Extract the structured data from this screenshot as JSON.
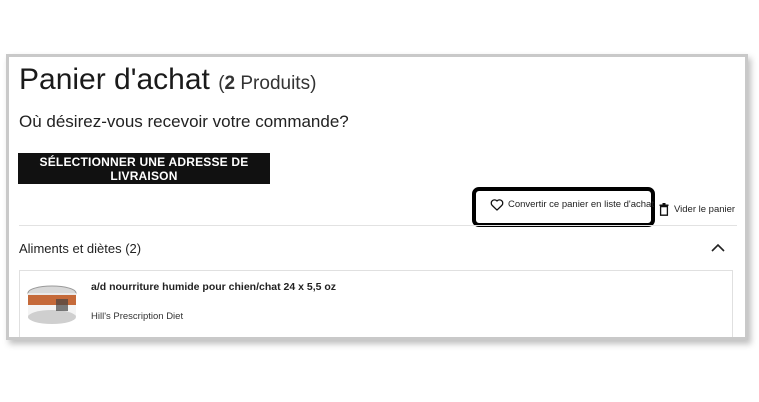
{
  "cart": {
    "title": "Panier d'achat",
    "count_open": "(",
    "count_number": "2",
    "count_label": " Produits)",
    "delivery_question": "Où désirez-vous recevoir votre commande?",
    "select_address_button": "SÉLECTIONNER UNE ADRESSE DE LIVRAISON",
    "convert_to_list_link": "Convertir ce panier en liste d'achat",
    "empty_cart_link": "Vider le panier"
  },
  "section": {
    "title": "Aliments et diètes (2)",
    "expanded": true
  },
  "products": [
    {
      "name": "a/d nourriture humide pour chien/chat 24 x 5,5 oz",
      "brand": "Hill's Prescription Diet"
    }
  ],
  "icons": {
    "convert": "heart-icon",
    "empty": "trash-icon",
    "collapse": "chevron-up-icon"
  },
  "colors": {
    "button_bg": "#111111",
    "highlight_border": "#000000"
  }
}
